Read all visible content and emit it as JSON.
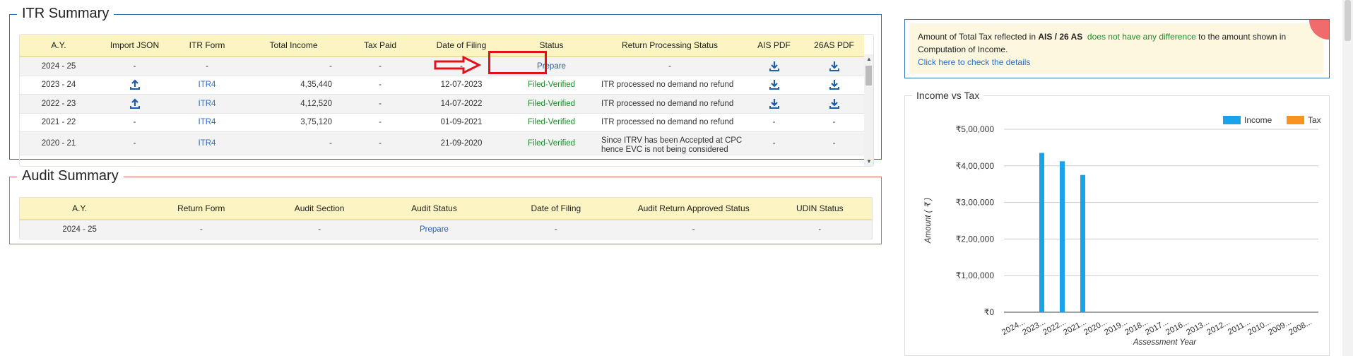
{
  "itr": {
    "title": "ITR Summary",
    "headers": [
      "A.Y.",
      "Import JSON",
      "ITR Form",
      "Total Income",
      "Tax Paid",
      "Date of Filing",
      "Status",
      "Return Processing Status",
      "AIS PDF",
      "26AS PDF"
    ],
    "rows": [
      {
        "ay": "2024 - 25",
        "import": "-",
        "form": "-",
        "income": "-",
        "tax": "-",
        "date": "-",
        "status": "Prepare",
        "rps": "-",
        "ais": "download",
        "as26": "download"
      },
      {
        "ay": "2023 - 24",
        "import": "upload",
        "form": "ITR4",
        "income": "4,35,440",
        "tax": "-",
        "date": "12-07-2023",
        "status": "Filed-Verified",
        "rps": "ITR processed no demand no refund",
        "ais": "download",
        "as26": "download"
      },
      {
        "ay": "2022 - 23",
        "import": "upload",
        "form": "ITR4",
        "income": "4,12,520",
        "tax": "-",
        "date": "14-07-2022",
        "status": "Filed-Verified",
        "rps": "ITR processed no demand no refund",
        "ais": "download",
        "as26": "download"
      },
      {
        "ay": "2021 - 22",
        "import": "-",
        "form": "ITR4",
        "income": "3,75,120",
        "tax": "-",
        "date": "01-09-2021",
        "status": "Filed-Verified",
        "rps": "ITR processed no demand no refund",
        "ais": "-",
        "as26": "-"
      },
      {
        "ay": "2020 - 21",
        "import": "-",
        "form": "ITR4",
        "income": "-",
        "tax": "-",
        "date": "21-09-2020",
        "status": "Filed-Verified",
        "rps": "Since ITRV has been Accepted at CPC hence EVC is not being considered",
        "ais": "-",
        "as26": "-"
      }
    ]
  },
  "audit": {
    "title": "Audit Summary",
    "headers": [
      "A.Y.",
      "Return Form",
      "Audit Section",
      "Audit Status",
      "Date of Filing",
      "Audit Return Approved Status",
      "UDIN Status"
    ],
    "row": {
      "ay": "2024 - 25",
      "form": "-",
      "section": "-",
      "status": "Prepare",
      "date": "-",
      "approved": "-",
      "udin": "-"
    }
  },
  "notice": {
    "text_a": "Amount of Total Tax reflected in ",
    "bold": "AIS / 26 AS",
    "green": "does not have any difference",
    "text_b": " to the amount shown in Computation of Income.",
    "link": "Click here to check the details"
  },
  "colors": {
    "income": "#1aa3e8",
    "tax": "#f7931e",
    "highlight": "#e3121a"
  },
  "chart_data": {
    "type": "bar",
    "title": "Income vs Tax",
    "xlabel": "Assessment Year",
    "ylabel": "Amount ( ₹ )",
    "ylim": [
      0,
      500000
    ],
    "yticks": [
      "₹0",
      "₹1,00,000",
      "₹2,00,000",
      "₹3,00,000",
      "₹4,00,000",
      "₹5,00,000"
    ],
    "categories": [
      "2024...",
      "2023...",
      "2022...",
      "2021...",
      "2020...",
      "2019...",
      "2018...",
      "2017...",
      "2016...",
      "2013...",
      "2012...",
      "2011...",
      "2010...",
      "2009...",
      "2008..."
    ],
    "series": [
      {
        "name": "Income",
        "values": [
          0,
          435440,
          412520,
          375120,
          0,
          0,
          0,
          0,
          0,
          0,
          0,
          0,
          0,
          0,
          0
        ]
      },
      {
        "name": "Tax",
        "values": [
          0,
          0,
          0,
          0,
          0,
          0,
          0,
          0,
          0,
          0,
          0,
          0,
          0,
          0,
          0
        ]
      }
    ],
    "legend": "top-right",
    "grid": true
  }
}
